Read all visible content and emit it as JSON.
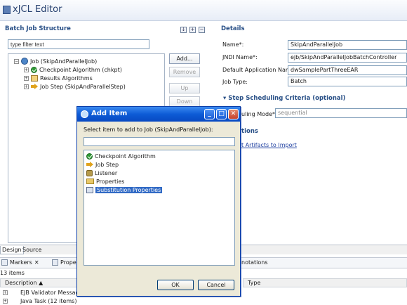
{
  "editor": {
    "title": "xJCL Editor",
    "tabs": [
      "Design",
      "Source"
    ]
  },
  "batch_job_structure": {
    "header": "Batch Job Structure",
    "filter_placeholder": "type filter text",
    "tree": [
      {
        "label": "Job (SkipAndParallelJob)",
        "icon": "job-icon",
        "expanded": true,
        "level": 0
      },
      {
        "label": "Checkpoint Algorithm (chkpt)",
        "icon": "checkpoint-icon",
        "expanded": false,
        "level": 1
      },
      {
        "label": "Results Algorithms",
        "icon": "algorithm-icon",
        "expanded": false,
        "level": 1
      },
      {
        "label": "Job Step (SkipAndParallelStep)",
        "icon": "job-step-icon",
        "expanded": false,
        "level": 1
      }
    ],
    "buttons": {
      "add": "Add...",
      "remove": "Remove",
      "up": "Up",
      "down": "Down"
    }
  },
  "details": {
    "header": "Details",
    "fields": [
      {
        "label": "Name*:",
        "value": "SkipAndParallelJob"
      },
      {
        "label": "JNDI Name*:",
        "value": "ejb/SkipAndParallelJobBatchController"
      },
      {
        "label": "Default Application Name:",
        "value": "dwSamplePartThreeEAR"
      },
      {
        "label": "Job Type:",
        "value": "Batch"
      }
    ],
    "step_section": "Step Scheduling Criteria (optional)",
    "scheduling_label": "uling Mode*:",
    "scheduling_value": "sequential",
    "options_header": "tions",
    "artifacts_link": "t Artifacts to Import"
  },
  "bottom_view": {
    "tabs": [
      "Markers",
      "Proper",
      "notations"
    ],
    "items_count": "13 items",
    "columns": [
      "Description",
      "Type"
    ],
    "rows": [
      {
        "label": "EJB Validator Message",
        "expanded": false
      },
      {
        "label": "Java Task (12 items)",
        "expanded": false
      }
    ]
  },
  "dialog": {
    "title": "Add Item",
    "prompt": "Select item to add to Job (SkipAndParallelJob):",
    "items": [
      {
        "label": "Checkpoint Algorithm",
        "icon": "checkpoint-icon",
        "selected": false
      },
      {
        "label": "Job Step",
        "icon": "job-step-icon",
        "selected": false
      },
      {
        "label": "Listener",
        "icon": "listener-icon",
        "selected": false
      },
      {
        "label": "Properties",
        "icon": "properties-icon",
        "selected": false
      },
      {
        "label": "Substitution Properties",
        "icon": "substitution-properties-icon",
        "selected": true
      }
    ],
    "ok": "OK",
    "cancel": "Cancel",
    "window_buttons": {
      "minimize": "_",
      "maximize": "□",
      "close": "✕"
    }
  },
  "colors": {
    "accent": "#284f86",
    "selection": "#316ac5",
    "dialog_title": "#0d5bd6"
  }
}
